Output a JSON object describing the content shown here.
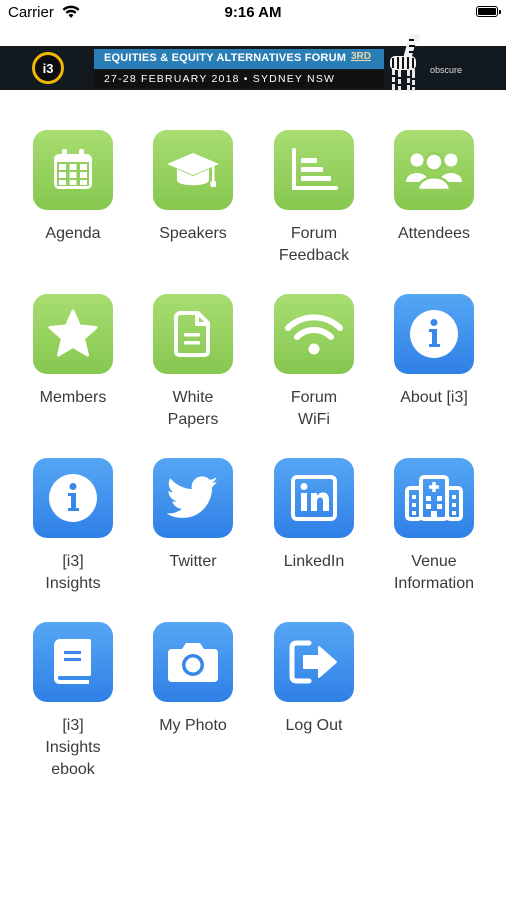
{
  "status_bar": {
    "carrier": "Carrier",
    "time": "9:16 AM"
  },
  "banner": {
    "logo_text": "i3",
    "title": "EQUITIES & EQUITY ALTERNATIVES FORUM",
    "badge": "3RD",
    "date": "27-28 FEBRUARY 2018 • SYDNEY NSW",
    "sponsor": "obscure"
  },
  "colors": {
    "green": "#96D15F",
    "blue": "#3F8EEC"
  },
  "tiles": [
    {
      "label": "Agenda",
      "icon": "calendar-icon",
      "color": "green"
    },
    {
      "label": "Speakers",
      "icon": "graduation-cap-icon",
      "color": "green"
    },
    {
      "label": "Forum\nFeedback",
      "icon": "bar-chart-icon",
      "color": "green"
    },
    {
      "label": "Attendees",
      "icon": "people-icon",
      "color": "green"
    },
    {
      "label": "Members",
      "icon": "star-icon",
      "color": "green"
    },
    {
      "label": "White\nPapers",
      "icon": "document-icon",
      "color": "green"
    },
    {
      "label": "Forum\nWiFi",
      "icon": "wifi-icon",
      "color": "green"
    },
    {
      "label": "About [i3]",
      "icon": "info-icon",
      "color": "blue"
    },
    {
      "label": "[i3]\nInsights",
      "icon": "info-icon",
      "color": "blue"
    },
    {
      "label": "Twitter",
      "icon": "twitter-icon",
      "color": "blue"
    },
    {
      "label": "LinkedIn",
      "icon": "linkedin-icon",
      "color": "blue"
    },
    {
      "label": "Venue\nInformation",
      "icon": "hospital-icon",
      "color": "blue"
    },
    {
      "label": "[i3]\nInsights\nebook",
      "icon": "book-icon",
      "color": "blue"
    },
    {
      "label": "My Photo",
      "icon": "camera-icon",
      "color": "blue"
    },
    {
      "label": "Log Out",
      "icon": "logout-icon",
      "color": "blue"
    }
  ]
}
